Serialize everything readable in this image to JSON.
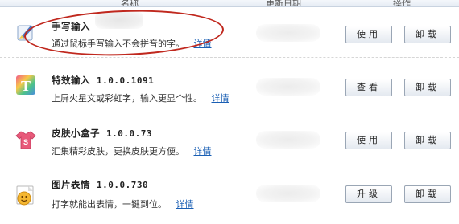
{
  "header": {
    "col_name": "名称",
    "col_date": "更新日期",
    "col_action": "操作"
  },
  "plugins": [
    {
      "icon": "pen-hand-icon",
      "name": "手写输入",
      "version": "",
      "desc": "通过鼠标手写输入不会拼音的字。",
      "detail": "详情",
      "primary": "使用",
      "secondary": "卸载"
    },
    {
      "icon": "special-text-T-icon",
      "name": "特效输入",
      "version": "1.0.0.1091",
      "desc": "上屏火星文或彩虹字，输入更显个性。",
      "detail": "详情",
      "primary": "查看",
      "secondary": "卸载"
    },
    {
      "icon": "skin-shirt-icon",
      "name": "皮肤小盒子",
      "version": "1.0.0.73",
      "desc": "汇集精彩皮肤，更换皮肤更方便。",
      "detail": "详情",
      "primary": "使用",
      "secondary": "卸载"
    },
    {
      "icon": "emoticon-image-icon",
      "name": "图片表情",
      "version": "1.0.0.730",
      "desc": "打字就能出表情，一键到位。",
      "detail": "详情",
      "primary": "升级",
      "secondary": "卸载"
    }
  ],
  "colors": {
    "annotation": "#c0281e",
    "link": "#1a5fb4"
  }
}
